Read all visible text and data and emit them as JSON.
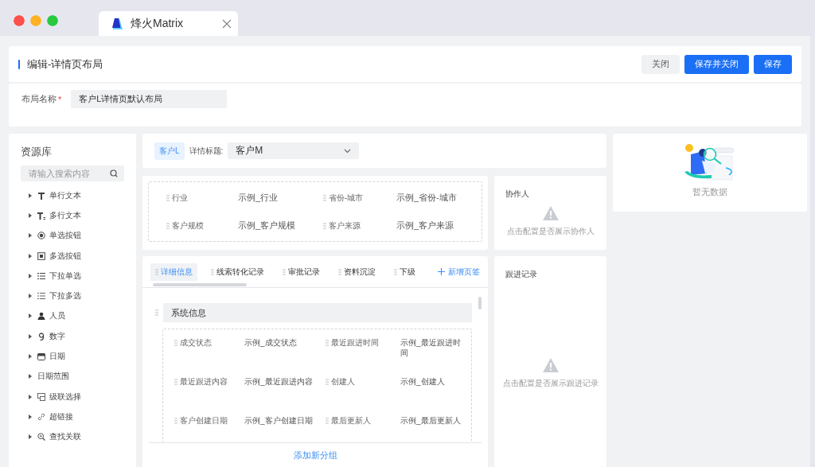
{
  "browser": {
    "tab_title": "烽火Matrix"
  },
  "header": {
    "title": "编辑-详情页布局",
    "buttons": [
      {
        "label": "关闭",
        "kind": "default"
      },
      {
        "label": "保存并关闭",
        "kind": "primary"
      },
      {
        "label": "保存",
        "kind": "primary"
      }
    ]
  },
  "layout_name": {
    "label": "布局名称",
    "required_mark": "*",
    "value": "客户L详情页默认布局"
  },
  "sidebar": {
    "title": "资源库",
    "search": {
      "placeholder": "请输入搜索内容"
    },
    "items": [
      {
        "label": "单行文本",
        "kind": "text"
      },
      {
        "label": "多行文本",
        "kind": "textarea"
      },
      {
        "label": "单选按钮",
        "kind": "radio"
      },
      {
        "label": "多选按钮",
        "kind": "checkbox"
      },
      {
        "label": "下拉单选",
        "kind": "select"
      },
      {
        "label": "下拉多选",
        "kind": "multiselect"
      },
      {
        "label": "人员",
        "kind": "person"
      },
      {
        "label": "数字",
        "kind": "number"
      },
      {
        "label": "日期",
        "kind": "date"
      },
      {
        "label": "日期范围",
        "kind": "plain"
      },
      {
        "label": "级联选择",
        "kind": "cascade"
      },
      {
        "label": "超链接",
        "kind": "link"
      },
      {
        "label": "查找关联",
        "kind": "lookup"
      }
    ]
  },
  "title_bar": {
    "tag": "客户L",
    "label": "详情标题:",
    "value": "客户M"
  },
  "summary_fields": [
    {
      "label": "行业",
      "value": "示例_行业"
    },
    {
      "label": "省份-城市",
      "value": "示例_省份-城市"
    },
    {
      "label": "客户规模",
      "value": "示例_客户规模"
    },
    {
      "label": "客户来源",
      "value": "示例_客户来源"
    }
  ],
  "collaborators": {
    "title": "协作人",
    "message": "点击配置是否展示协作人"
  },
  "tabs": [
    {
      "label": "详细信息",
      "selected": true
    },
    {
      "label": "线索转化记录",
      "selected": false
    },
    {
      "label": "审批记录",
      "selected": false
    },
    {
      "label": "资料沉淀",
      "selected": false
    },
    {
      "label": "下级",
      "selected": false
    }
  ],
  "add_tab": "新增页签",
  "group": {
    "title": "系统信息",
    "fields": [
      {
        "label": "成交状态",
        "value": "示例_成交状态"
      },
      {
        "label": "最近跟进时间",
        "value": "示例_最近跟进时间"
      },
      {
        "label": "最近跟进内容",
        "value": "示例_最近跟进内容"
      },
      {
        "label": "创建人",
        "value": "示例_创建人"
      },
      {
        "label": "客户创建日期",
        "value": "示例_客户创建日期"
      },
      {
        "label": "最后更新人",
        "value": "示例_最后更新人"
      }
    ]
  },
  "add_group": "添加新分组",
  "follow_up": {
    "title": "跟进记录",
    "message": "点击配置是否展示跟进记录"
  },
  "empty": {
    "message": "暂无数据"
  }
}
